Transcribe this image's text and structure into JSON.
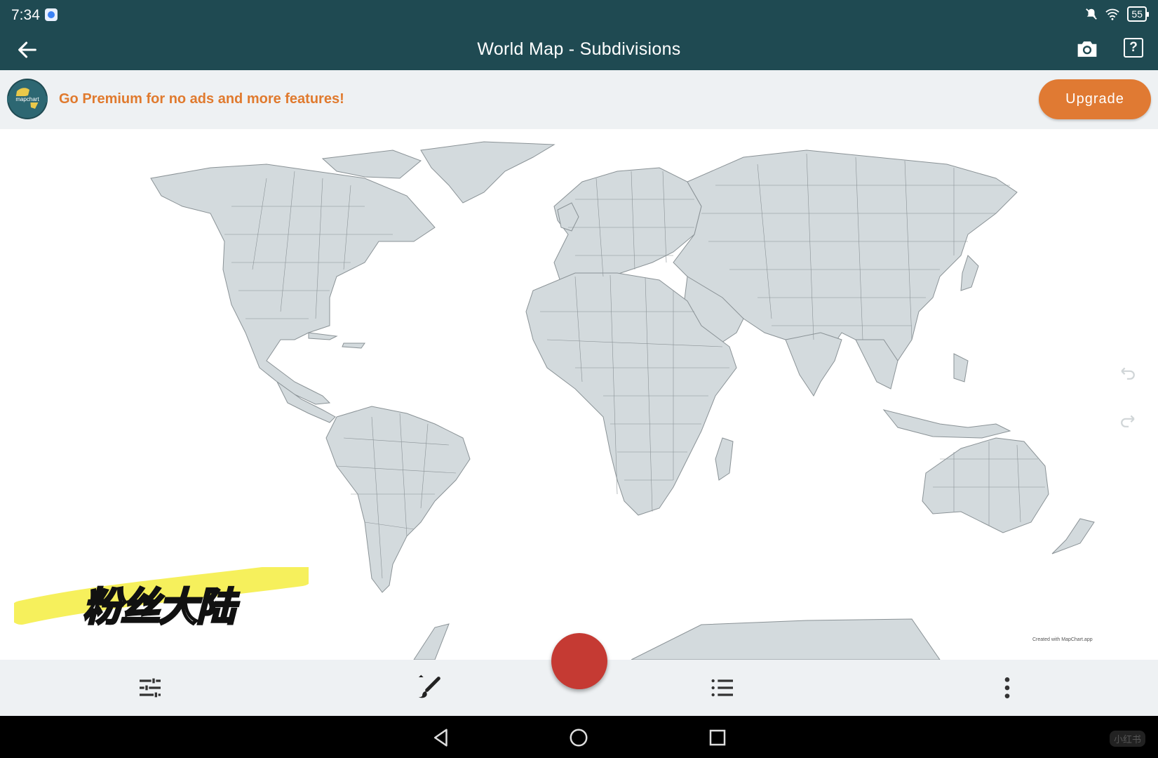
{
  "status_bar": {
    "time": "7:34",
    "battery": "55"
  },
  "app_bar": {
    "title": "World Map - Subdivisions",
    "back_icon": "arrow-left-icon",
    "camera_icon": "camera-icon",
    "help_icon": "help-icon",
    "help_glyph": "?"
  },
  "banner": {
    "logo_text": "mapchart",
    "message": "Go Premium for no ads and more features!",
    "upgrade_label": "Upgrade",
    "accent_color": "#e07a33"
  },
  "map": {
    "credit": "Created with MapChart.app",
    "land_color": "#d3dadd",
    "background_color": "#ffffff"
  },
  "overlay": {
    "sticker_text": "粉丝大陆"
  },
  "toolbar": {
    "settings_icon": "sliders-icon",
    "paint_icon": "paintbrush-icon",
    "color_button_color": "#c53a33",
    "legend_icon": "list-icon",
    "more_icon": "more-vertical-icon"
  },
  "nav_bar": {
    "back_icon": "nav-back-icon",
    "home_icon": "nav-home-icon",
    "recents_icon": "nav-recents-icon",
    "brand": "小红书"
  },
  "theme": {
    "primary": "#1f4a52"
  }
}
